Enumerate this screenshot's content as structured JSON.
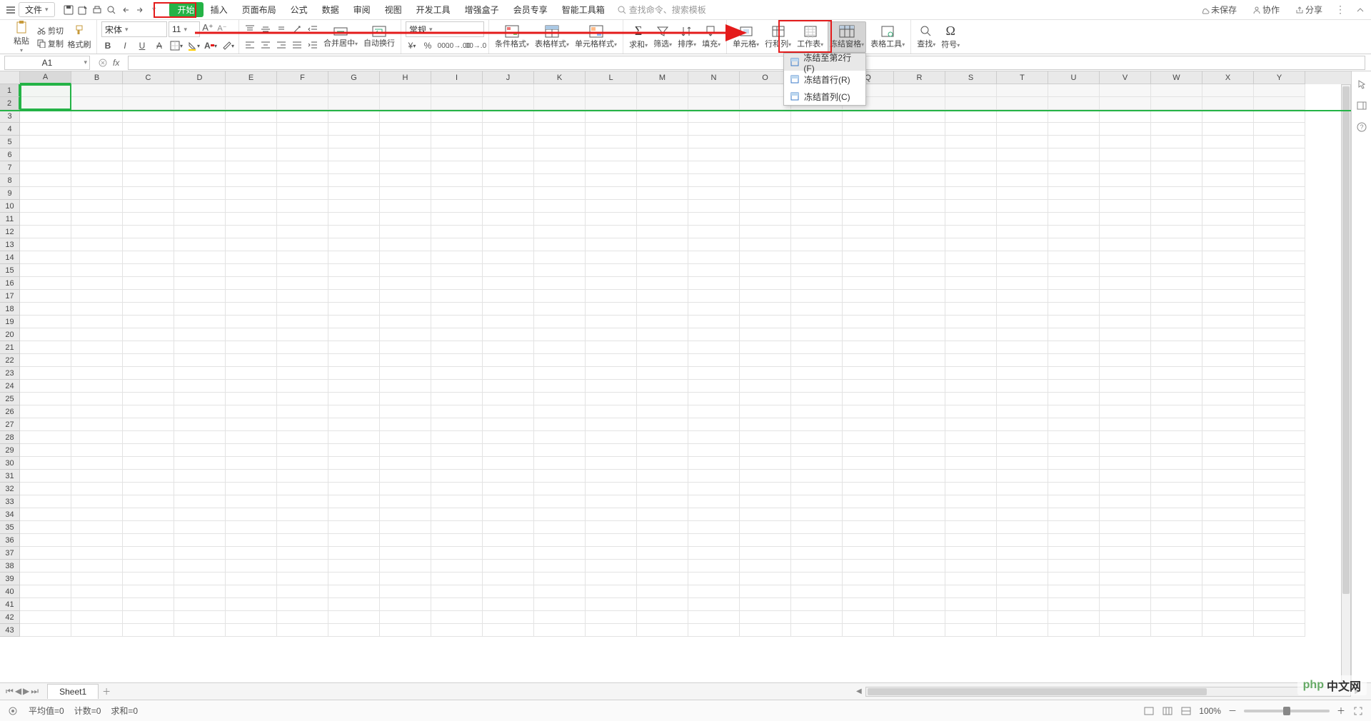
{
  "menubar": {
    "file_label": "文件",
    "tabs": [
      "开始",
      "插入",
      "页面布局",
      "公式",
      "数据",
      "审阅",
      "视图",
      "开发工具",
      "增强盒子",
      "会员专享",
      "智能工具箱"
    ],
    "active_tab_index": 0,
    "search_placeholder": "查找命令、搜索模板",
    "right": {
      "unsaved": "未保存",
      "collab": "协作",
      "share": "分享"
    }
  },
  "ribbon": {
    "paste": "粘贴",
    "cut": "剪切",
    "copy": "复制",
    "format_painter": "格式刷",
    "font_name": "宋体",
    "font_size": "11",
    "merge_center": "合并居中",
    "wrap": "自动换行",
    "number_format": "常规",
    "cond_format": "条件格式",
    "table_format": "表格样式",
    "cell_style": "单元格样式",
    "sum": "求和",
    "filter": "筛选",
    "sort": "排序",
    "fill": "填充",
    "cell": "单元格",
    "row_col": "行和列",
    "worksheet": "工作表",
    "freeze": "冻结窗格",
    "table_tools": "表格工具",
    "find": "查找",
    "symbol": "符号"
  },
  "formula_bar": {
    "name_box": "A1"
  },
  "sheet": {
    "columns": [
      "A",
      "B",
      "C",
      "D",
      "E",
      "F",
      "G",
      "H",
      "I",
      "J",
      "K",
      "L",
      "M",
      "N",
      "O",
      "P",
      "Q",
      "R",
      "S",
      "T",
      "U",
      "V",
      "W",
      "X",
      "Y"
    ],
    "row_count": 43,
    "active_cell": "A1",
    "frozen_rows": 2
  },
  "freeze_menu": {
    "items": [
      {
        "label": "冻结至第2行(F)",
        "highlight": true
      },
      {
        "label": "冻结首行(R)",
        "highlight": false
      },
      {
        "label": "冻结首列(C)",
        "highlight": false
      }
    ]
  },
  "tabbar": {
    "sheet_name": "Sheet1"
  },
  "status": {
    "avg": "平均值=0",
    "count": "计数=0",
    "sum": "求和=0",
    "zoom": "100%"
  },
  "watermark": "中文网"
}
